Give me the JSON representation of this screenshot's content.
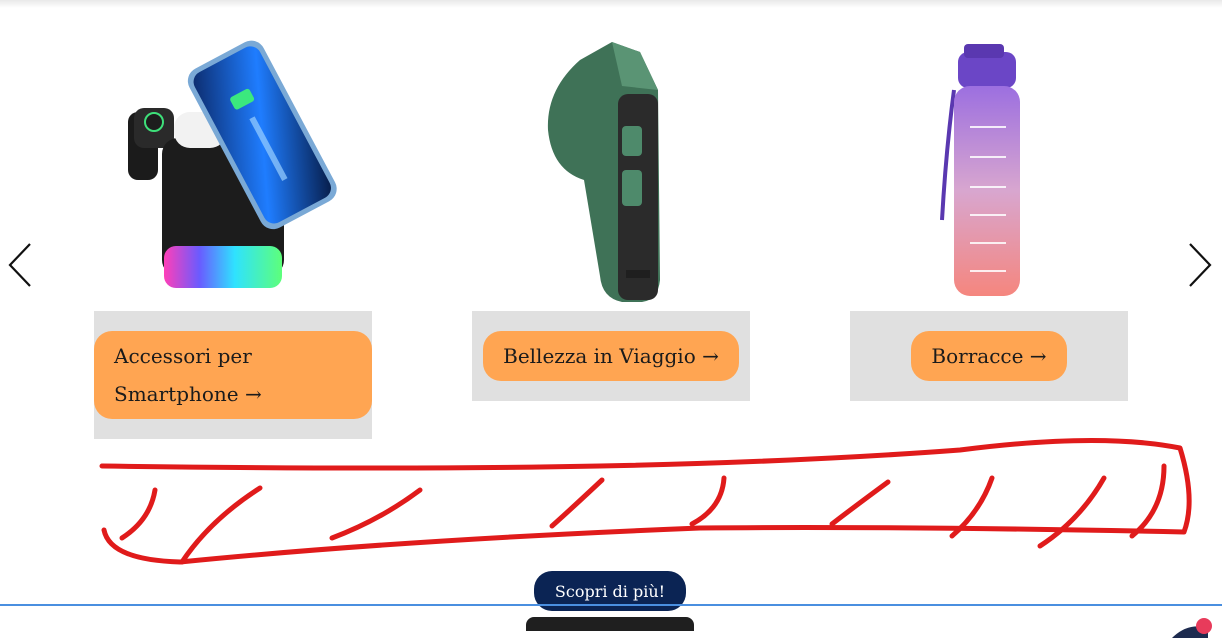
{
  "carousel": {
    "prev_icon": "chevron-left-icon",
    "next_icon": "chevron-right-icon",
    "items": [
      {
        "label": "Accessori per",
        "label2": "Smartphone →",
        "image": "wireless-charger-stand-image"
      },
      {
        "label": "Bellezza in Viaggio →",
        "image": "travel-steam-iron-image"
      },
      {
        "label": "Borracce →",
        "image": "water-bottle-image"
      }
    ]
  },
  "cta": {
    "label": "Scopri di più!"
  },
  "colors": {
    "pill": "#ffa552",
    "box": "#e0e0e0",
    "cta": "#0b2454",
    "scribble": "#e01b1b",
    "line": "#4a8fe0"
  }
}
